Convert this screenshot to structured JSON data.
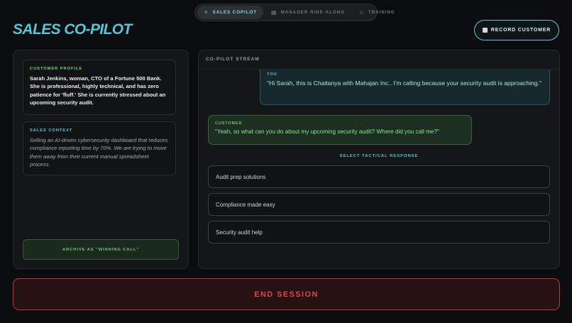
{
  "nav": {
    "tabs": [
      {
        "label": "SALES COPILOT",
        "icon": "sparkle-icon",
        "active": true
      },
      {
        "label": "MANAGER RIDE-ALONG",
        "icon": "grid-icon",
        "active": false
      },
      {
        "label": "TRAINING",
        "icon": "swords-icon",
        "active": false
      }
    ]
  },
  "header": {
    "title": "SALES CO-PILOT",
    "record_label": "RECORD CUSTOMER"
  },
  "left": {
    "profile": {
      "label": "CUSTOMER PROFILE",
      "text": "Sarah Jenkins, woman, CTO of a Fortune 500 Bank. She is professional, highly technical, and has zero patience for 'fluff.' She is currently stressed about an upcoming security audit."
    },
    "context": {
      "label": "SALES CONTEXT",
      "text": "Selling an AI-driven cybersecurity dashboard that reduces compliance reporting time by 70%. We are trying to move them away from their current manual spreadsheet process."
    },
    "archive_label": "ARCHIVE AS \"WINNING CALL\""
  },
  "stream": {
    "header": "CO-PILOT STREAM",
    "messages": [
      {
        "who": "YOU",
        "text": "\"Hi Sarah, this is Chaitanya with Mahajan Inc.. I'm calling because your security audit is approaching.\""
      },
      {
        "who": "CUSTOMER",
        "text": "\"Yeah, so what can you do about my upcoming security audit? Where did you call me?\""
      }
    ],
    "tactical_label": "SELECT TACTICAL RESPONSE",
    "options": [
      "Audit prep solutions",
      "Compliance made easy",
      "Security audit help"
    ]
  },
  "end_label": "END SESSION",
  "colors": {
    "accent": "#4ec9d9",
    "success": "#6fd66f",
    "danger": "#e0454e",
    "background": "#0b0c0d"
  }
}
